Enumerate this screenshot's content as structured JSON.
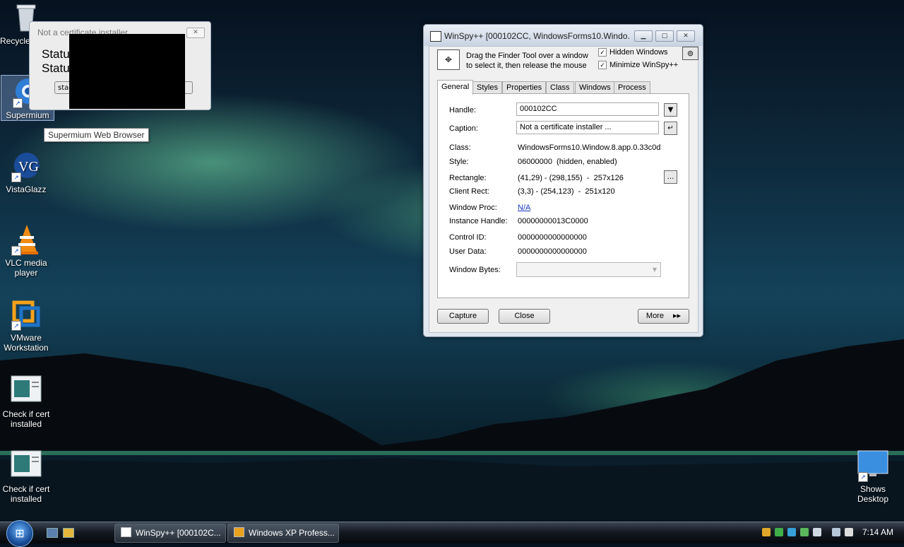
{
  "desktop_icons": [
    {
      "label": "Recycle Bin",
      "icon": "recycle-bin-icon"
    },
    {
      "label": "Supermium",
      "icon": "supermium-icon"
    },
    {
      "label": "VistaGlazz",
      "icon": "vistaglazz-icon"
    },
    {
      "label": "VLC media player",
      "icon": "vlc-icon"
    },
    {
      "label": "VMware Workstation",
      "icon": "vmware-icon"
    },
    {
      "label": "Check if cert installed",
      "icon": "script-icon"
    },
    {
      "label": "Check if cert installed",
      "icon": "script-icon"
    },
    {
      "label": "Shows Desktop",
      "icon": "show-desktop-icon"
    }
  ],
  "tooltip": "Supermium Web Browser",
  "small_window": {
    "title": "Not a certificate installer",
    "status1": "Status",
    "status2": "Status",
    "button_fragment": "stal"
  },
  "winspy": {
    "title": "WinSpy++ [000102CC, WindowsForms10.Windo...",
    "hint_line1": "Drag the Finder Tool over a window",
    "hint_line2": "to select it, then release the mouse",
    "hidden_windows": "Hidden Windows",
    "minimize": "Minimize WinSpy++",
    "tabs": [
      "General",
      "Styles",
      "Properties",
      "Class",
      "Windows",
      "Process"
    ],
    "labels": {
      "handle": "Handle:",
      "caption": "Caption:",
      "class": "Class:",
      "style": "Style:",
      "rectangle": "Rectangle:",
      "client_rect": "Client Rect:",
      "window_proc": "Window Proc:",
      "instance_handle": "Instance Handle:",
      "control_id": "Control ID:",
      "user_data": "User Data:",
      "window_bytes": "Window Bytes:"
    },
    "values": {
      "handle": "000102CC",
      "caption": "Not a certificate installer ...",
      "class": "WindowsForms10.Window.8.app.0.33c0d",
      "style": "06000000  (hidden, enabled)",
      "rectangle": "(41,29) - (298,155)  -  257x126",
      "client_rect": "(3,3) - (254,123)  -  251x120",
      "window_proc": "N/A",
      "instance_handle": "00000000013C0000",
      "control_id": "0000000000000000",
      "user_data": "0000000000000000"
    },
    "buttons": {
      "capture": "Capture",
      "close": "Close",
      "more": "More"
    }
  },
  "taskbar": {
    "items": [
      "WinSpy++ [000102C...",
      "Windows XP Profess..."
    ],
    "clock": "7:14 AM"
  }
}
